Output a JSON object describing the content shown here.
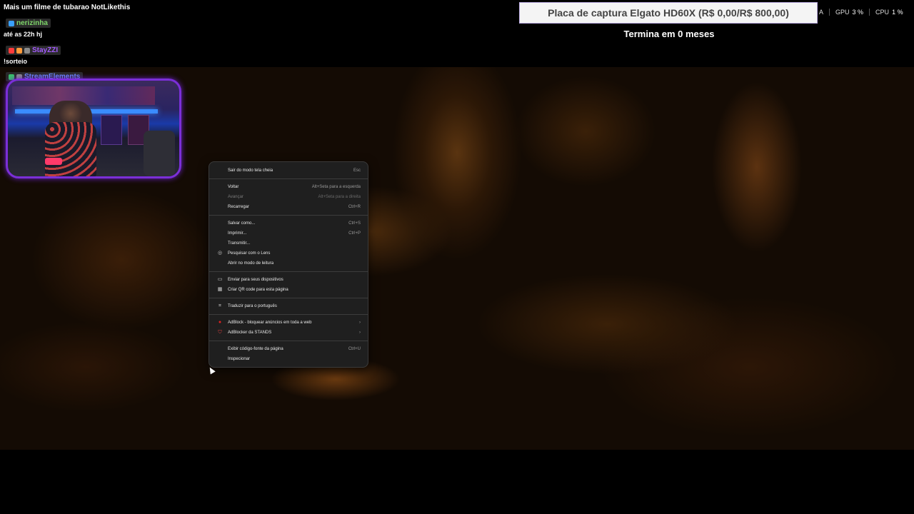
{
  "stream_title": "Mais um filme de tubarao NotLikethis",
  "chat": [
    {
      "user": "nerizinha",
      "user_color": "#7fd66a",
      "message": "até as 22h hj"
    },
    {
      "user": "StayZZI",
      "user_color": "#a45cff",
      "message": "!sorteio"
    },
    {
      "user": "StreamElements",
      "user_color": "#6a8cff",
      "message": ""
    }
  ],
  "goal": {
    "text": "Placa de captura Elgato HD60X (R$ 0,00/R$ 800,00)",
    "subtitle": "Termina em 0 meses"
  },
  "stats": [
    {
      "label": "A",
      "value": ""
    },
    {
      "label": "GPU",
      "value": "3 %"
    },
    {
      "label": "CPU",
      "value": "1 %"
    }
  ],
  "context_menu": {
    "items": [
      {
        "label": "Sair do modo tela cheia",
        "shortcut": "Esc",
        "icon": "",
        "disabled": false
      },
      {
        "label": "Voltar",
        "shortcut": "Alt+Seta para a esquerda",
        "icon": "",
        "disabled": false
      },
      {
        "label": "Avançar",
        "shortcut": "Alt+Seta para a direita",
        "icon": "",
        "disabled": true
      },
      {
        "label": "Recarregar",
        "shortcut": "Ctrl+R",
        "icon": "",
        "disabled": false
      },
      {
        "label": "Salvar como...",
        "shortcut": "Ctrl+S",
        "icon": "",
        "disabled": false
      },
      {
        "label": "Imprimir...",
        "shortcut": "Ctrl+P",
        "icon": "",
        "disabled": false
      },
      {
        "label": "Transmitir...",
        "shortcut": "",
        "icon": "",
        "disabled": false
      },
      {
        "label": "Pesquisar com o Lens",
        "shortcut": "",
        "icon": "lens-icon",
        "disabled": false
      },
      {
        "label": "Abrir no modo de leitura",
        "shortcut": "",
        "icon": "",
        "disabled": false
      },
      {
        "label": "Enviar para seus dispositivos",
        "shortcut": "",
        "icon": "device-icon",
        "disabled": false
      },
      {
        "label": "Criar QR code para esta página",
        "shortcut": "",
        "icon": "qr-code-icon",
        "disabled": false
      },
      {
        "label": "Traduzir para o português",
        "shortcut": "",
        "icon": "translate-icon",
        "disabled": false
      },
      {
        "label": "AdBlock - bloquear anúncios em toda a web",
        "shortcut": "›",
        "icon": "adblock-icon",
        "disabled": false
      },
      {
        "label": "AdBlocker da STANDS",
        "shortcut": "›",
        "icon": "shield-icon",
        "disabled": false
      },
      {
        "label": "Exibir código-fonte da página",
        "shortcut": "Ctrl+U",
        "icon": "",
        "disabled": false
      },
      {
        "label": "Inspecionar",
        "shortcut": "",
        "icon": "",
        "disabled": false
      }
    ]
  }
}
